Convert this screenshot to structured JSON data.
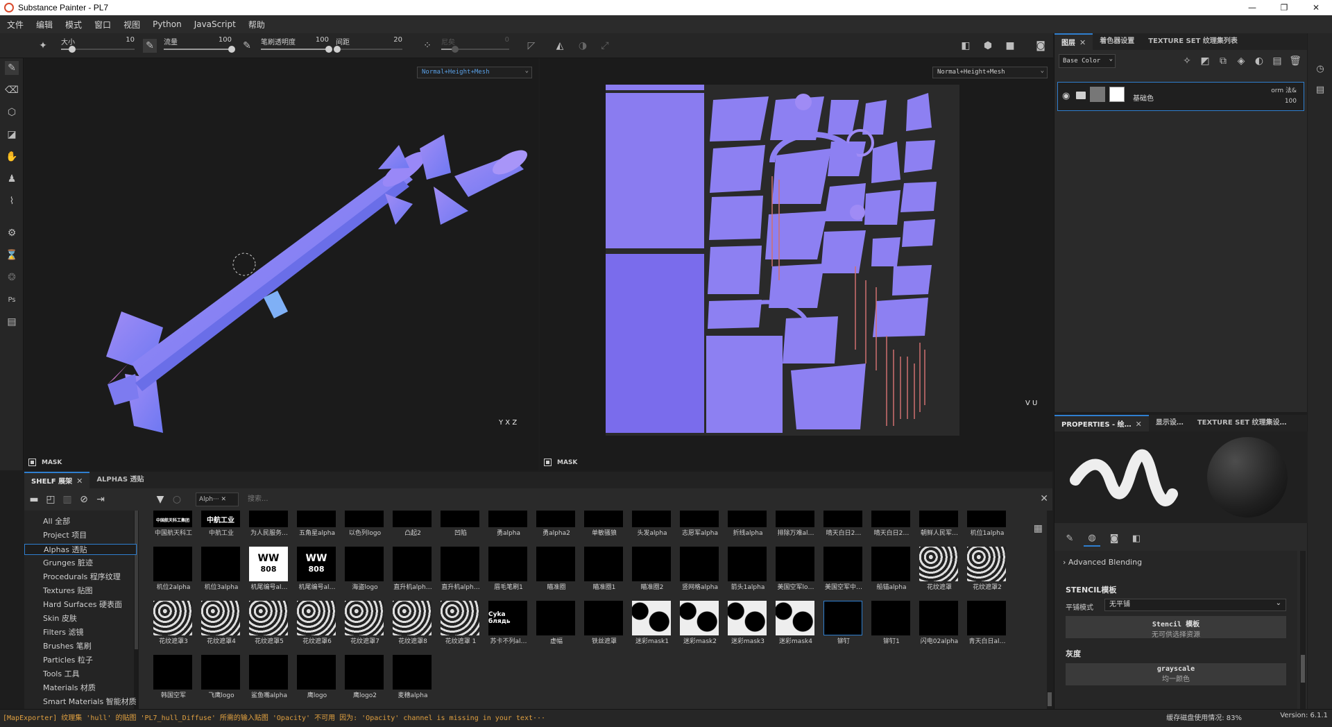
{
  "window": {
    "title": "Substance Painter - PL7",
    "controls": [
      "—",
      "❐",
      "✕"
    ]
  },
  "menu": [
    "文件",
    "编辑",
    "模式",
    "窗口",
    "视图",
    "Python",
    "JavaScript",
    "帮助"
  ],
  "toolbar": {
    "size": {
      "label": "大小",
      "value": "10",
      "fraction": 0.15
    },
    "flow": {
      "label": "流量",
      "value": "100",
      "fraction": 1.0
    },
    "stroke_opacity": {
      "label": "笔刷透明度",
      "value": "100",
      "fraction": 1.0
    },
    "spacing": {
      "label": "间距",
      "value": "20",
      "fraction": 0.02
    },
    "angle": {
      "label": "尼矣",
      "value": "0",
      "fraction": 0.2
    }
  },
  "viewport3d": {
    "mode": "Normal+Height+Mesh",
    "mask_label": "MASK",
    "axes": "Y X Z"
  },
  "viewport2d": {
    "mode": "Normal+Height+Mesh",
    "mask_label": "MASK",
    "axes": "V U"
  },
  "layers_panel": {
    "tabs": [
      "图层",
      "着色器设置",
      "TEXTURE SET 纹理集列表"
    ],
    "channel": "Base Color",
    "layer": {
      "name": "基础色",
      "blend": "orm 法&",
      "opacity": "100"
    }
  },
  "properties_panel": {
    "tabs": [
      "PROPERTIES - 绘…",
      "显示设…",
      "TEXTURE SET 纹理集设…"
    ],
    "advanced_blending": "Advanced Blending",
    "stencil_title": "STENCIL模板",
    "tiling_label": "平铺模式",
    "tiling_value": "无平铺",
    "stencil_slot": {
      "title": "Stencil 模板",
      "sub": "无可供选择资源"
    },
    "gray_title": "灰度",
    "gray_slot": {
      "title": "grayscale",
      "sub": "均一颜色"
    }
  },
  "shelf": {
    "tabs": [
      "SHELF 展架",
      "ALPHAS 透贴"
    ],
    "filter_chip": "Alph···",
    "search_placeholder": "搜索...",
    "categories": [
      "All 全部",
      "Project 项目",
      "Alphas 透贴",
      "Grunges 脏迹",
      "Procedurals 程序纹理",
      "Textures 贴图",
      "Hard Surfaces 硬表面",
      "Skin 皮肤",
      "Filters 滤镜",
      "Brushes 笔刷",
      "Particles 粒子",
      "Tools 工具",
      "Materials 材质",
      "Smart Materials 智能材质"
    ],
    "active_category": 2,
    "rows": [
      [
        "中国航天科工",
        "中航工业",
        "为人民服务…",
        "五角星alpha",
        "以色列logo",
        "凸起2",
        "凹陷",
        "勇alpha",
        "勇alpha2",
        "单敏骚狼",
        "头发alpha",
        "志愿军alpha",
        "折线alpha",
        "排除万难al…",
        "晴天白日2…",
        "晴天白日2…",
        "朝鲜人民军…",
        "机位1alpha"
      ],
      [
        "机位2alpha",
        "机位3alpha",
        "机尾编号al…",
        "机尾编号al…",
        "海盗logo",
        "直升机alph…",
        "直升机alph…",
        "眉毛笔刷1",
        "瞄准圈",
        "瞄准圈1",
        "瞄准圈2",
        "竖网格alpha",
        "箭头1alpha",
        "美国空军lo…",
        "美国空军中…",
        "船锚alpha",
        "花纹遮罩",
        "花纹遮罩2"
      ],
      [
        "花纹遮罩3",
        "花纹遮罩4",
        "花纹遮罩5",
        "花纹遮罩6",
        "花纹遮罩7",
        "花纹遮罩8",
        "花纹遮罩 1",
        "苏卡不列al…",
        "虚幅",
        "铁丝遮罩",
        "迷彩mask1",
        "迷彩mask2",
        "迷彩mask3",
        "迷彩mask4",
        "铆钉",
        "铆钉1",
        "闪电02alpha",
        "青天白日al…"
      ],
      [
        "韩国空军",
        "飞鹰logo",
        "鲨鱼嘴alpha",
        "鹰logo",
        "鹰logo2",
        "麦穗alpha"
      ]
    ],
    "selected_item": "铆钉",
    "thumb_texts": {
      "zhonghang": "中航工业",
      "ww1": "WW",
      "ww1_sub": "808",
      "suka": "Cyka блядь",
      "china_aero": "中国航天科工集团"
    }
  },
  "status": {
    "message": "[MapExporter] 纹理集 'hull' 的贴图 'PL7_hull_Diffuse' 所需的输入贴图 'Opacity' 不可用 因为: 'Opacity' channel is missing in your text···",
    "cache": "缓存磁盘使用情况: 83%",
    "version": "Version: 6.1.1"
  },
  "colors": {
    "accent": "#2f7fd0",
    "normal_map": "#8a7cf0",
    "warning": "#e0a040"
  }
}
